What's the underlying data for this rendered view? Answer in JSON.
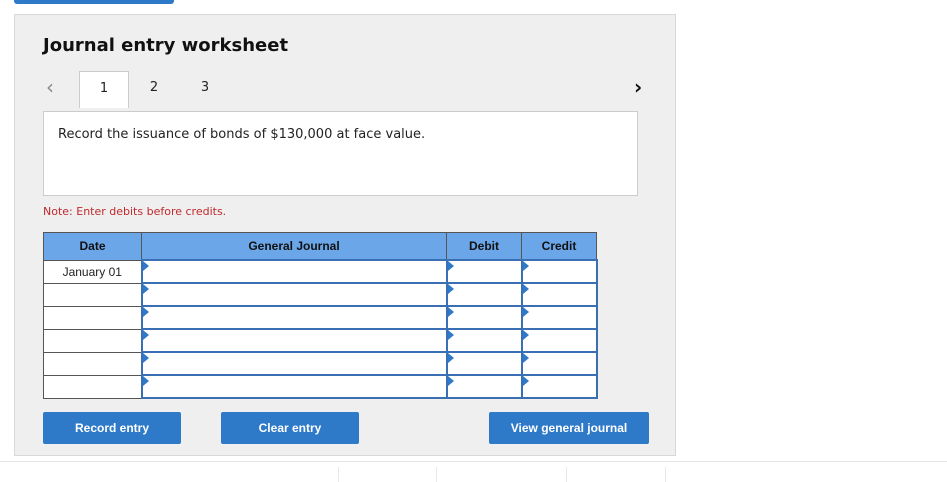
{
  "worksheet": {
    "title": "Journal entry worksheet",
    "nav_prev_icon": "chevron-left-icon",
    "nav_next_icon": "chevron-right-icon",
    "tabs": [
      {
        "label": "1"
      },
      {
        "label": "2"
      },
      {
        "label": "3"
      }
    ],
    "active_tab": "1",
    "prompt": "Record the issuance of bonds of $130,000 at face value.",
    "note": "Note: Enter debits before credits."
  },
  "journal": {
    "headers": {
      "date": "Date",
      "account": "General Journal",
      "debit": "Debit",
      "credit": "Credit"
    },
    "rows": [
      {
        "date": "January 01",
        "account": "",
        "debit": "",
        "credit": ""
      },
      {
        "date": "",
        "account": "",
        "debit": "",
        "credit": ""
      },
      {
        "date": "",
        "account": "",
        "debit": "",
        "credit": ""
      },
      {
        "date": "",
        "account": "",
        "debit": "",
        "credit": ""
      },
      {
        "date": "",
        "account": "",
        "debit": "",
        "credit": ""
      },
      {
        "date": "",
        "account": "",
        "debit": "",
        "credit": ""
      }
    ]
  },
  "buttons": {
    "record": "Record entry",
    "clear": "Clear entry",
    "view": "View general journal"
  },
  "colors": {
    "accent": "#2f7ac8",
    "header_bg": "#6aa6e8",
    "note": "#c0282d",
    "panel_bg": "#efefef"
  }
}
